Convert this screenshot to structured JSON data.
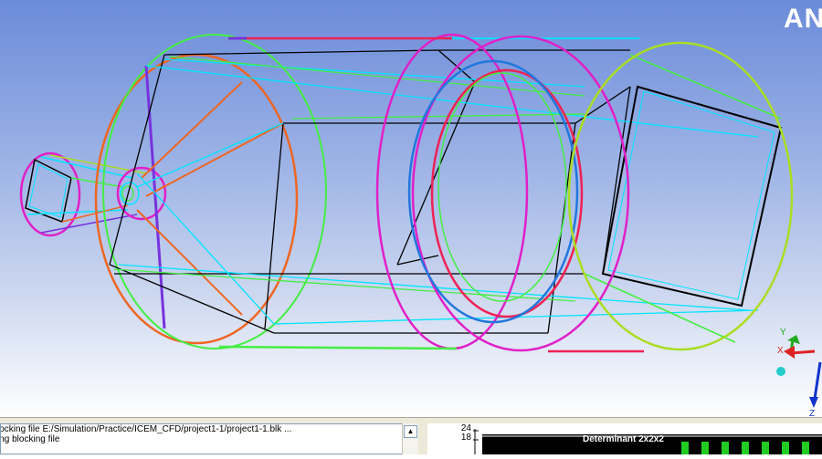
{
  "viewport": {
    "brand_text": "AN",
    "triad": {
      "y_label": "Y",
      "x_label": "X",
      "z_label": "Z"
    }
  },
  "message_log": {
    "lines": [
      "locking file E:/Simulation/Practice/ICEM_CFD/project1-1/project1-1.blk ...",
      "ing blocking file"
    ],
    "scroll_up_icon": "arrow-up-icon"
  },
  "histogram": {
    "title": "Determinant 2x2x2",
    "y_ticks": [
      "24",
      "18"
    ]
  },
  "colors": {
    "bg_top": "#6b8bd9",
    "wire_black": "#000000",
    "wire_cyan": "#00e5ff",
    "wire_green": "#44ee44",
    "wire_magenta": "#e020c8",
    "wire_red": "#ee2255",
    "wire_orange": "#ee6622",
    "wire_blue": "#2277dd",
    "wire_purple": "#7733dd",
    "wire_yellowgreen": "#aadd22"
  }
}
